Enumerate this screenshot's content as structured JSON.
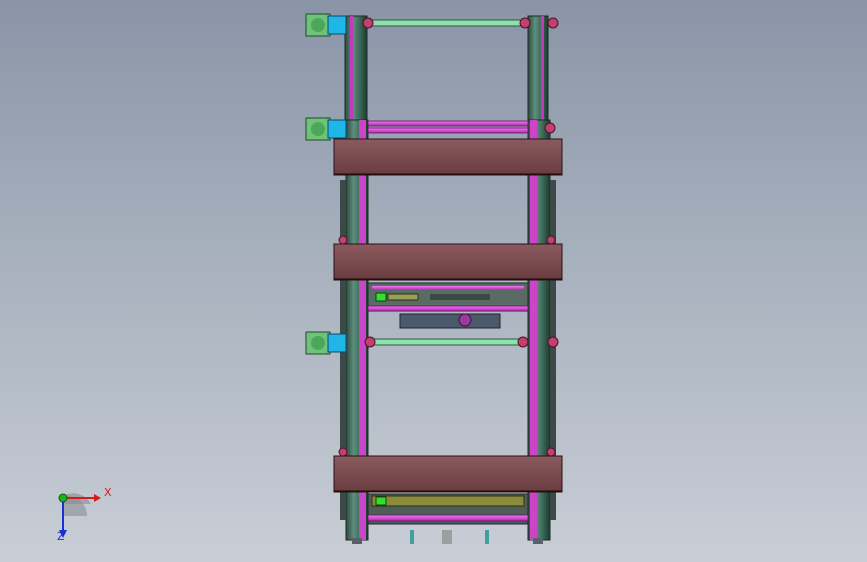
{
  "viewport": {
    "background_top": "#8995a7",
    "background_bottom": "#c9ced6"
  },
  "model": {
    "colors": {
      "frame_column": "#3e6b5a",
      "frame_column_edge": "#1e3a30",
      "magenta_rail": "#d23ad0",
      "brown_plate": "#7a4a4e",
      "motor_green": "#6fc27a",
      "motor_cyan": "#1fb6e8",
      "shaft": "#8fe0b0",
      "base_feet": "#40a0a0"
    },
    "icons": [
      "stepper-motor-icon"
    ]
  },
  "triad": {
    "x_label": "X",
    "z_label": "Z",
    "x_color": "#d41a1a",
    "y_color": "#1ab31a",
    "z_color": "#1a2fd4"
  }
}
